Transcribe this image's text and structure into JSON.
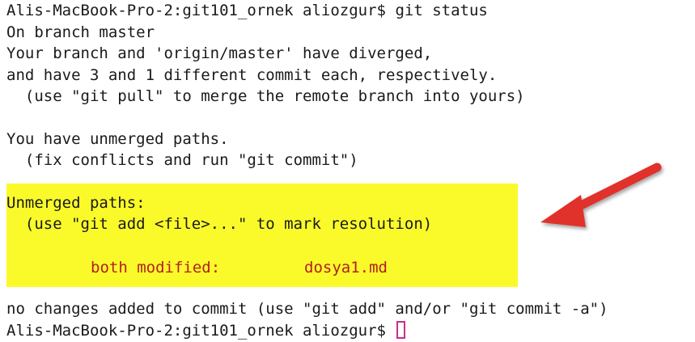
{
  "terminal": {
    "prompt": "Alis-MacBook-Pro-2:git101_ornek aliozgur$",
    "command": "git status",
    "output": {
      "branch": "On branch master",
      "diverged_1": "Your branch and 'origin/master' have diverged,",
      "diverged_2": "and have 3 and 1 different commit each, respectively.",
      "diverged_hint": "  (use \"git pull\" to merge the remote branch into yours)",
      "unmerged_msg": "You have unmerged paths.",
      "unmerged_hint": "  (fix conflicts and run \"git commit\")",
      "unmerged_header": "Unmerged paths:",
      "unmerged_add_hint": "  (use \"git add <file>...\" to mark resolution)",
      "conflict_status": "both modified:",
      "conflict_file": "dosya1.md",
      "no_changes": "no changes added to commit (use \"git add\" and/or \"git commit -a\")"
    },
    "final_prompt": "Alis-MacBook-Pro-2:git101_ornek aliozgur$"
  },
  "colors": {
    "highlight": "#fafa2a",
    "conflict_text": "#b22020",
    "arrow": "#e0322a",
    "cursor": "#c2328a"
  },
  "icons": {
    "annotation": "arrow-icon",
    "cursor": "block-cursor"
  }
}
